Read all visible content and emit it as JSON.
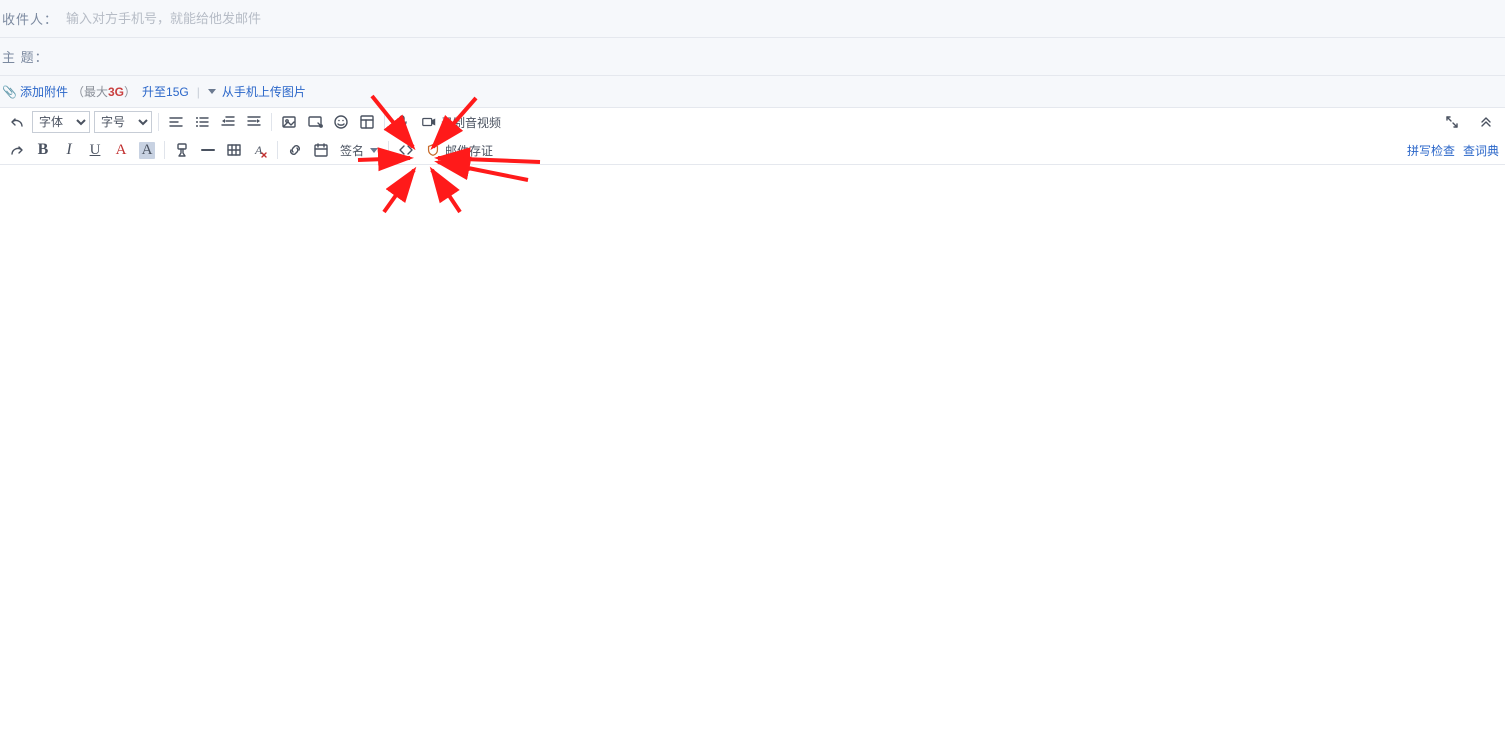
{
  "header": {
    "recipient_label": "收件人：",
    "recipient_placeholder": "输入对方手机号，就能给他发邮件",
    "subject_label": "主 题："
  },
  "attach": {
    "add_label": "添加附件",
    "max_prefix": "（最大",
    "max_size": "3G",
    "max_suffix": "）",
    "upgrade_label": "升至15G",
    "upload_label": "从手机上传图片"
  },
  "toolbar": {
    "font_select": "字体",
    "size_select": "字号",
    "record_label": "录制音视频",
    "signature_label": "签名",
    "notarize_label": "邮件存证",
    "spellcheck_label": "拼写检查",
    "dictionary_label": "查词典"
  }
}
